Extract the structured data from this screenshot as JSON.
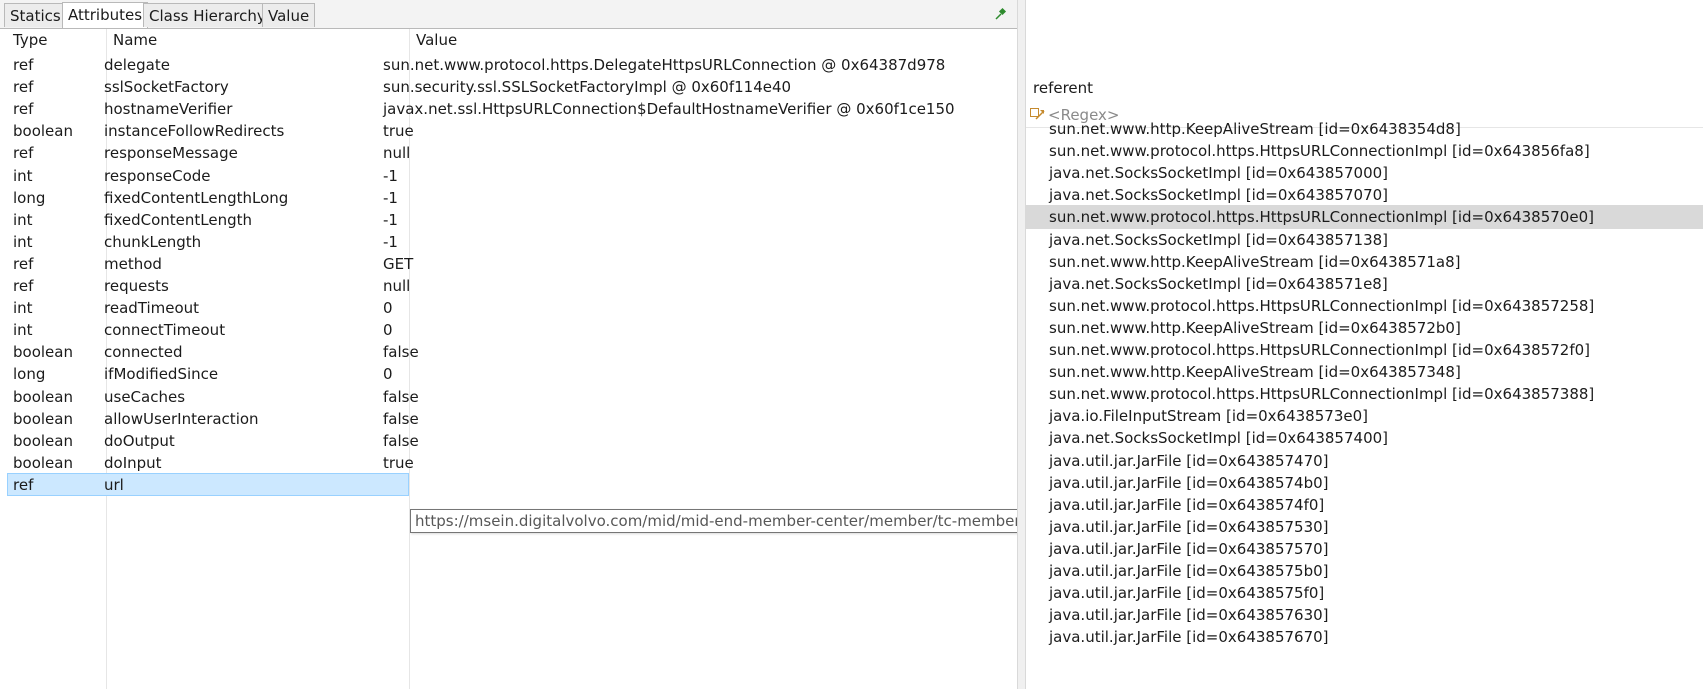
{
  "tabs": [
    "Statics",
    "Attributes",
    "Class Hierarchy",
    "Value"
  ],
  "active_tab": "Attributes",
  "columns": {
    "type": "Type",
    "name": "Name",
    "value": "Value"
  },
  "rows": [
    {
      "type": "ref",
      "name": "delegate",
      "value": "sun.net.www.protocol.https.DelegateHttpsURLConnection @ 0x64387d978"
    },
    {
      "type": "ref",
      "name": "sslSocketFactory",
      "value": "sun.security.ssl.SSLSocketFactoryImpl @ 0x60f114e40"
    },
    {
      "type": "ref",
      "name": "hostnameVerifier",
      "value": "javax.net.ssl.HttpsURLConnection$DefaultHostnameVerifier @ 0x60f1ce150"
    },
    {
      "type": "boolean",
      "name": "instanceFollowRedirects",
      "value": "true"
    },
    {
      "type": "ref",
      "name": "responseMessage",
      "value": "null"
    },
    {
      "type": "int",
      "name": "responseCode",
      "value": "-1"
    },
    {
      "type": "long",
      "name": "fixedContentLengthLong",
      "value": "-1"
    },
    {
      "type": "int",
      "name": "fixedContentLength",
      "value": "-1"
    },
    {
      "type": "int",
      "name": "chunkLength",
      "value": "-1"
    },
    {
      "type": "ref",
      "name": "method",
      "value": "GET"
    },
    {
      "type": "ref",
      "name": "requests",
      "value": "null"
    },
    {
      "type": "int",
      "name": "readTimeout",
      "value": "0"
    },
    {
      "type": "int",
      "name": "connectTimeout",
      "value": "0"
    },
    {
      "type": "boolean",
      "name": "connected",
      "value": "false"
    },
    {
      "type": "long",
      "name": "ifModifiedSince",
      "value": "0"
    },
    {
      "type": "boolean",
      "name": "useCaches",
      "value": "false"
    },
    {
      "type": "boolean",
      "name": "allowUserInteraction",
      "value": "false"
    },
    {
      "type": "boolean",
      "name": "doOutput",
      "value": "false"
    },
    {
      "type": "boolean",
      "name": "doInput",
      "value": "true"
    },
    {
      "type": "ref",
      "name": "url",
      "value": ""
    }
  ],
  "tooltip": "https://msein.digitalvolvo.com/mid/mid-end-member-center/member/tc-member-info/getMemberInfoByIdList",
  "referent": {
    "title": "referent",
    "regex_placeholder": "<Regex>",
    "items": [
      "sun.net.www.http.KeepAliveStream [id=0x6438354d8]",
      "sun.net.www.protocol.https.HttpsURLConnectionImpl [id=0x643856fa8]",
      "java.net.SocksSocketImpl [id=0x643857000]",
      "java.net.SocksSocketImpl [id=0x643857070]",
      "sun.net.www.protocol.https.HttpsURLConnectionImpl [id=0x6438570e0]",
      "java.net.SocksSocketImpl [id=0x643857138]",
      "sun.net.www.http.KeepAliveStream [id=0x6438571a8]",
      "java.net.SocksSocketImpl [id=0x6438571e8]",
      "sun.net.www.protocol.https.HttpsURLConnectionImpl [id=0x643857258]",
      "sun.net.www.http.KeepAliveStream [id=0x6438572b0]",
      "sun.net.www.protocol.https.HttpsURLConnectionImpl [id=0x6438572f0]",
      "sun.net.www.http.KeepAliveStream [id=0x643857348]",
      "sun.net.www.protocol.https.HttpsURLConnectionImpl [id=0x643857388]",
      "java.io.FileInputStream [id=0x6438573e0]",
      "java.net.SocksSocketImpl [id=0x643857400]",
      "java.util.jar.JarFile [id=0x643857470]",
      "java.util.jar.JarFile [id=0x6438574b0]",
      "java.util.jar.JarFile [id=0x6438574f0]",
      "java.util.jar.JarFile [id=0x643857530]",
      "java.util.jar.JarFile [id=0x643857570]",
      "java.util.jar.JarFile [id=0x6438575b0]",
      "java.util.jar.JarFile [id=0x6438575f0]",
      "java.util.jar.JarFile [id=0x643857630]",
      "java.util.jar.JarFile [id=0x643857670]"
    ]
  },
  "colors": {
    "selection": "#cce8ff",
    "highlight": "#d9d9d9",
    "pin": "#2e8b2e"
  }
}
